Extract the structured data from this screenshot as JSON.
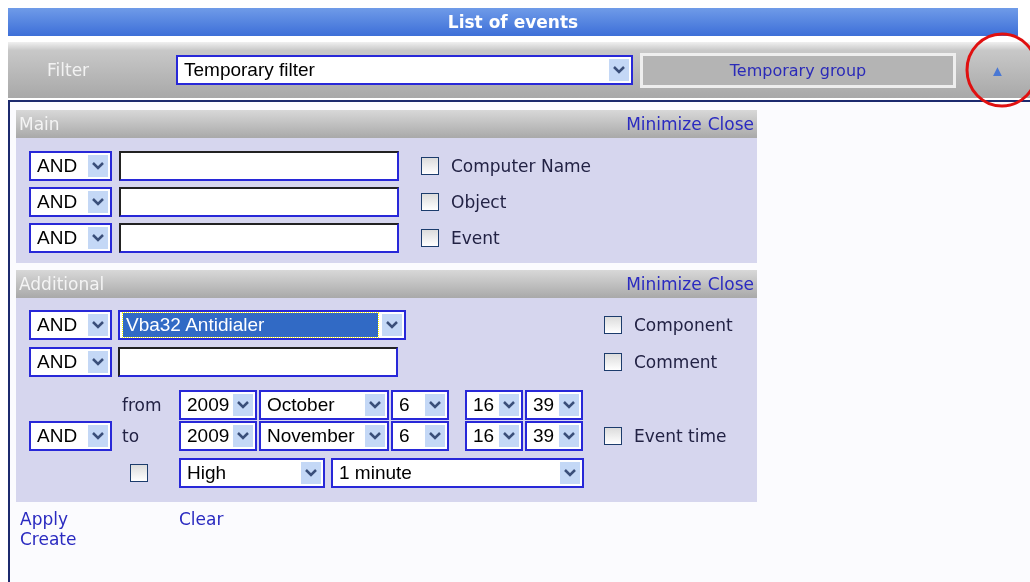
{
  "title": "List of events",
  "filter": {
    "label": "Filter",
    "value": "Temporary filter",
    "group_button": "Temporary group",
    "collapse_icon": "▲"
  },
  "panels": [
    {
      "title": "Main",
      "links": [
        "Minimize",
        "Close"
      ],
      "rows": [
        {
          "kind": "text",
          "operator": "AND",
          "value": "",
          "checkbox": {
            "label": "Computer Name",
            "checked": false
          }
        },
        {
          "kind": "text",
          "operator": "AND",
          "value": "",
          "checkbox": {
            "label": "Object",
            "checked": false
          }
        },
        {
          "kind": "text",
          "operator": "AND",
          "value": "",
          "checkbox": {
            "label": "Event",
            "checked": false
          }
        }
      ]
    },
    {
      "title": "Additional",
      "links": [
        "Minimize",
        "Close"
      ],
      "rows": [
        {
          "kind": "select",
          "operator": "AND",
          "value": "Vba32 Antidialer",
          "highlighted": true,
          "checkbox": {
            "label": "Component",
            "checked": false
          }
        },
        {
          "kind": "text",
          "operator": "AND",
          "value": "",
          "checkbox": {
            "label": "Comment",
            "checked": false
          }
        },
        {
          "kind": "daterange",
          "operator": "AND",
          "from_label": "from",
          "to_label": "to",
          "from": {
            "year": "2009",
            "month": "October",
            "day": "6",
            "hour": "16",
            "minute": "39"
          },
          "to": {
            "year": "2009",
            "month": "November",
            "day": "6",
            "hour": "16",
            "minute": "39"
          },
          "repeat_checked": false,
          "priority": "High",
          "interval": "1 minute",
          "checkbox": {
            "label": "Event time",
            "checked": false
          }
        }
      ]
    }
  ],
  "actions": [
    {
      "label": "Apply"
    },
    {
      "label": "Create"
    },
    {
      "label": "Clear"
    }
  ]
}
